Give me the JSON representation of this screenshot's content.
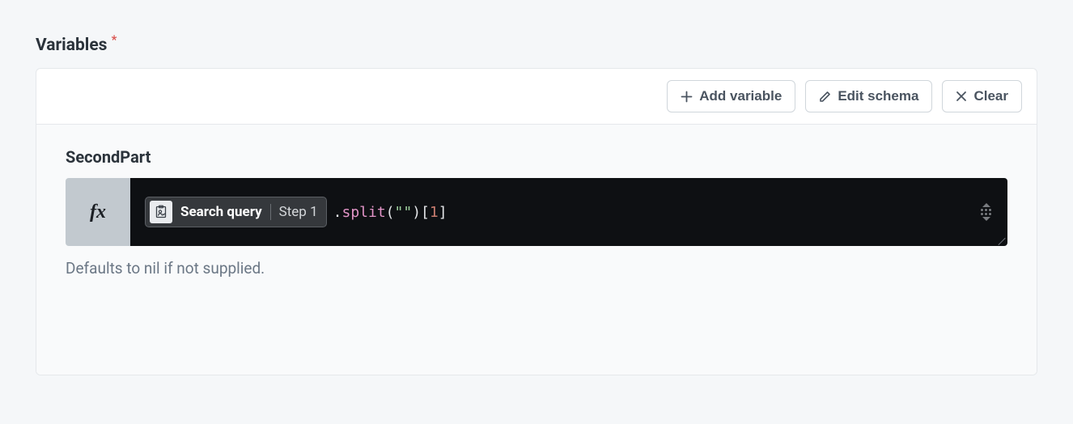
{
  "section": {
    "title": "Variables",
    "required_marker": "*"
  },
  "toolbar": {
    "add_variable_label": "Add variable",
    "edit_schema_label": "Edit schema",
    "clear_label": "Clear"
  },
  "variable": {
    "name": "SecondPart",
    "fx_label": "fx",
    "pill": {
      "label": "Search query",
      "step": "Step 1"
    },
    "expression": {
      "dot": ".",
      "method": "split",
      "open_paren": "(",
      "string_open": "\"",
      "string_val": " ",
      "string_close": "\"",
      "close_paren": ")",
      "open_bracket": "[",
      "index": "1",
      "close_bracket": "]"
    },
    "help_text": "Defaults to nil if not supplied."
  }
}
